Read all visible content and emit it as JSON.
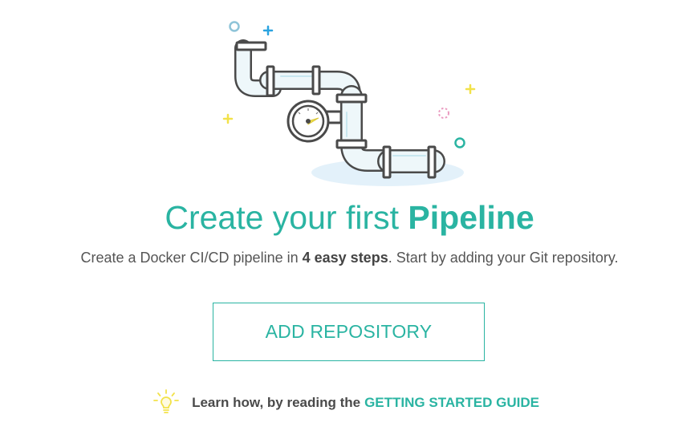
{
  "headline": {
    "light": "Create your first",
    "strong": "Pipeline"
  },
  "subtitle": {
    "before": "Create a Docker CI/CD pipeline in",
    "bold": "4 easy steps",
    "after": ". Start by adding your Git repository."
  },
  "add_repository_button": "ADD REPOSITORY",
  "learn": {
    "text": "Learn how, by reading the",
    "link": "GETTING STARTED GUIDE",
    "icon": "lightbulb-icon"
  },
  "colors": {
    "accent": "#2ab4a2",
    "text": "#555555",
    "decor_yellow": "#f2e24a",
    "decor_blue": "#2aa3e0",
    "decor_pink": "#ea9bc0"
  }
}
